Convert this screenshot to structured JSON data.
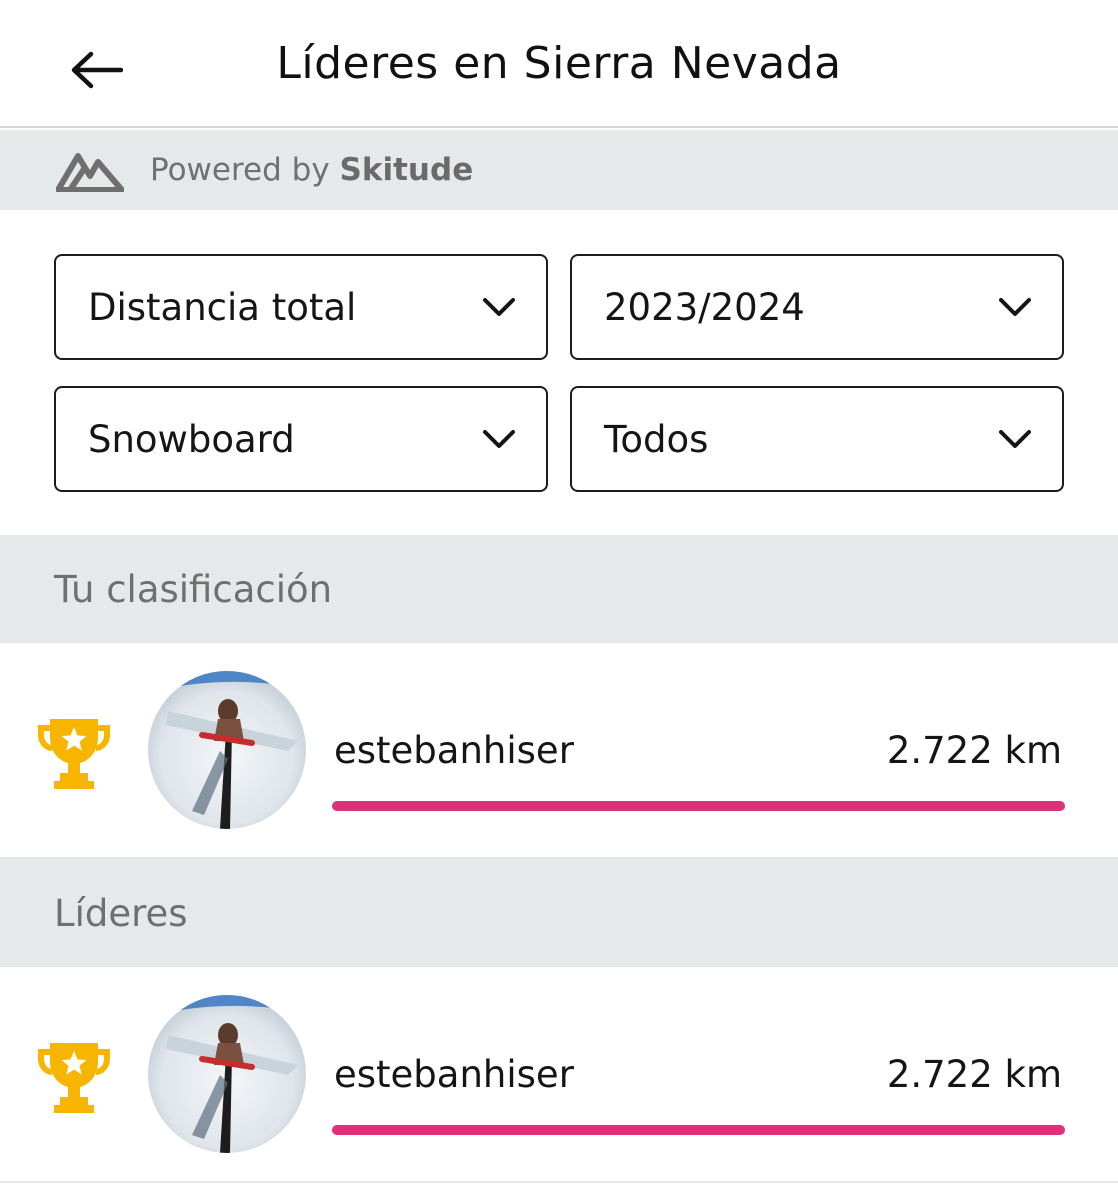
{
  "header": {
    "title": "Líderes en Sierra Nevada",
    "back_icon": "arrow-left-icon"
  },
  "powered": {
    "prefix": "Powered by",
    "brand": "Skitude",
    "logo_icon": "skitude-mountain-logo"
  },
  "filters": {
    "metric": "Distancia total",
    "season": "2023/2024",
    "sport": "Snowboard",
    "group": "Todos",
    "dropdown_icon": "chevron-down-icon"
  },
  "my_ranking": {
    "section_label": "Tu clasificación",
    "entry": {
      "username": "estebanhiser",
      "distance": "2.722 km",
      "progress": 1.0,
      "trophy_icon": "trophy-star-icon"
    }
  },
  "leaders": {
    "section_label": "Líderes",
    "entries": [
      {
        "username": "estebanhiser",
        "distance": "2.722 km",
        "progress": 1.0,
        "trophy_icon": "trophy-star-icon"
      }
    ]
  },
  "colors": {
    "accent_bar": "#e0307a",
    "trophy": "#f7b500",
    "section_bg": "#e6e9ea"
  }
}
